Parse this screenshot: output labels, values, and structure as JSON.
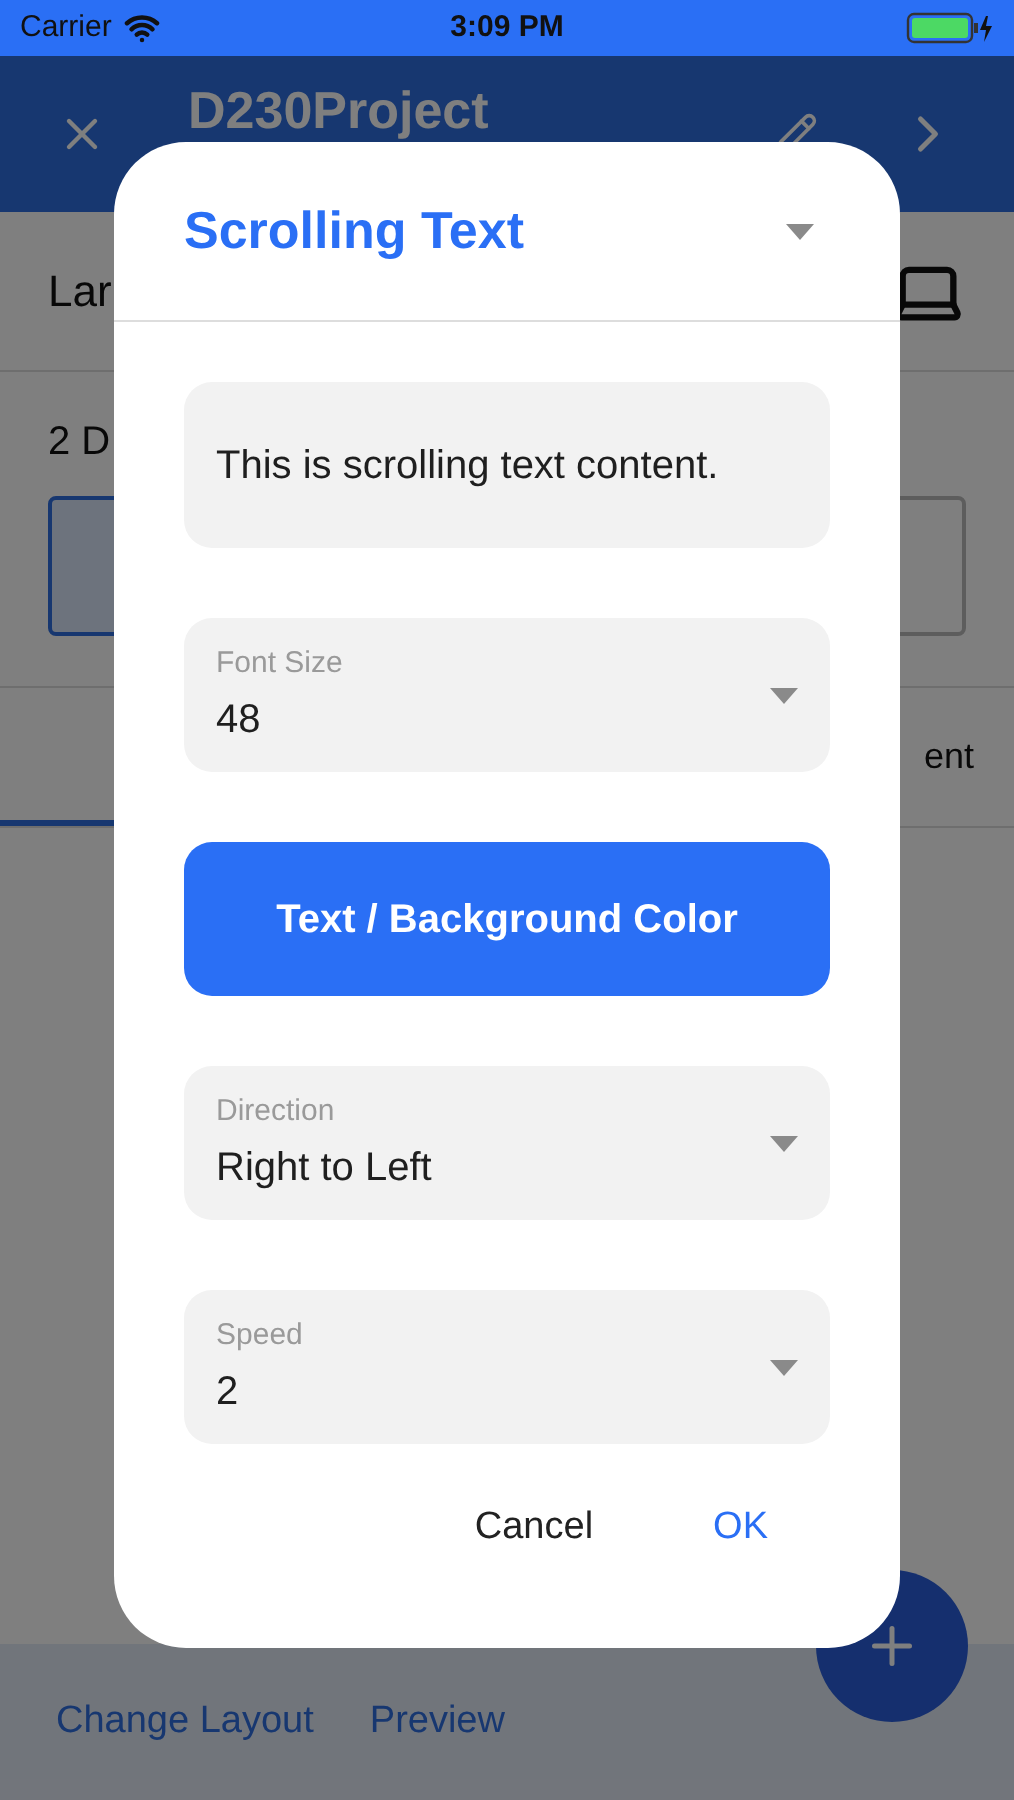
{
  "status_bar": {
    "carrier": "Carrier",
    "time": "3:09 PM"
  },
  "nav_bar": {
    "title": "D230Project"
  },
  "background": {
    "row_label": "Lar",
    "section_label": "2 D",
    "tab_label": "ent"
  },
  "bottom_bar": {
    "actions": [
      "Change Layout",
      "Preview"
    ]
  },
  "dialog": {
    "title": "Scrolling Text",
    "text_content": "This is scrolling text content.",
    "fields": [
      {
        "kind": "select",
        "label": "Font Size",
        "value": "48"
      },
      {
        "kind": "button",
        "label": "Text / Background Color"
      },
      {
        "kind": "select",
        "label": "Direction",
        "value": "Right to Left"
      },
      {
        "kind": "select",
        "label": "Speed",
        "value": "2"
      }
    ],
    "buttons": [
      {
        "label": "Cancel",
        "kind": "secondary"
      },
      {
        "label": "OK",
        "kind": "primary"
      }
    ]
  }
}
